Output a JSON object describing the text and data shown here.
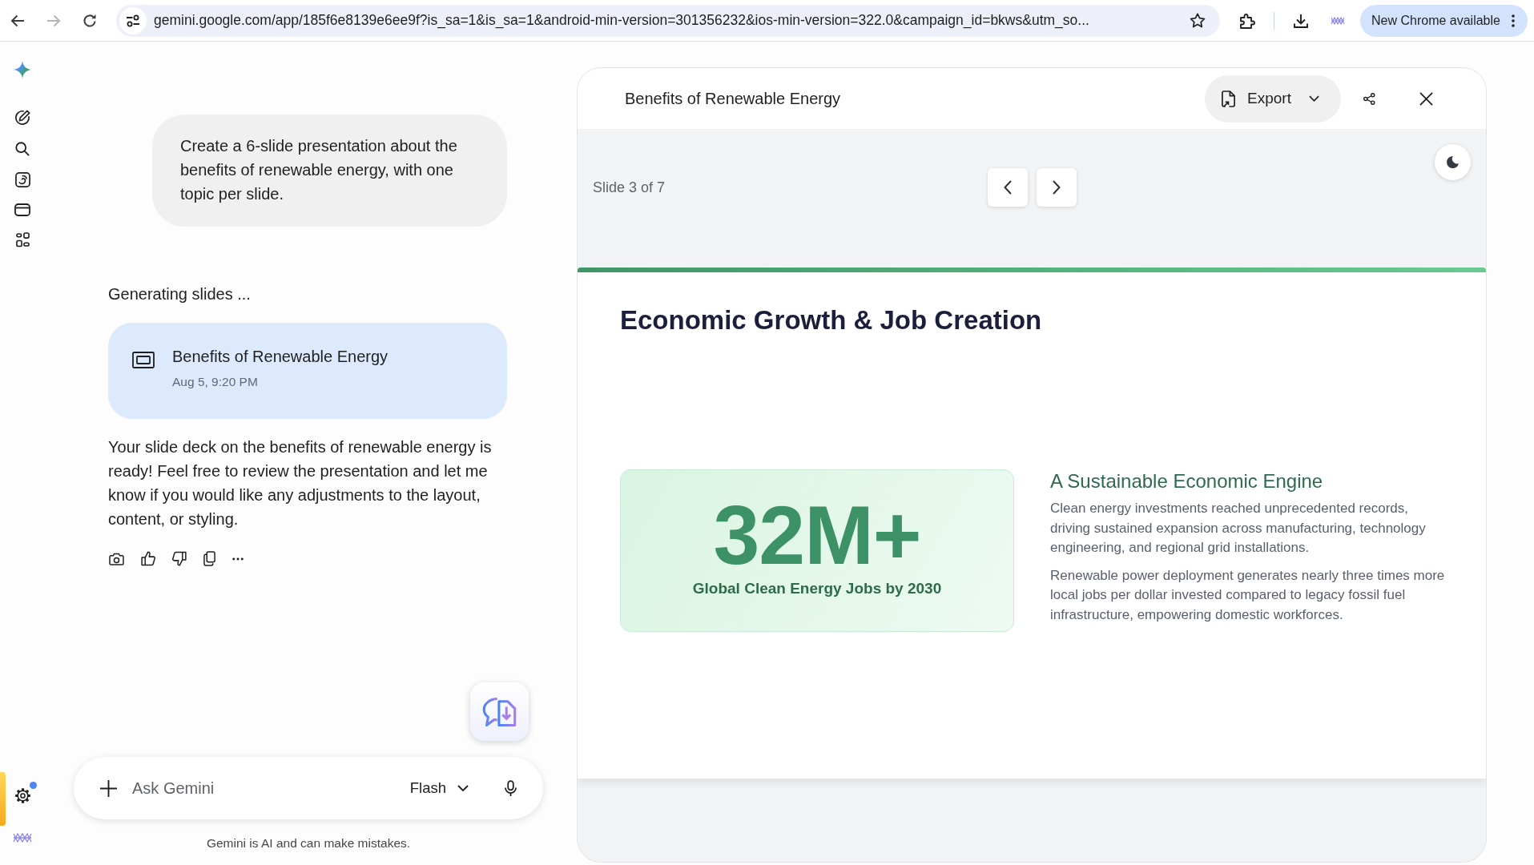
{
  "browser": {
    "nav_buttons": [
      {
        "kind": "back",
        "disabled": false
      },
      {
        "kind": "forward",
        "disabled": true
      },
      {
        "kind": "reload",
        "disabled": false
      }
    ],
    "url": "gemini.google.com/app/185f6e8139e6ee9f?is_sa=1&is_sa=1&android-min-version=301356232&ios-min-version=322.0&campaign_id=bkws&utm_so...",
    "update_button": "New Chrome available"
  },
  "sidebar": {
    "settings_notification": true
  },
  "chat": {
    "user_message": "Create a 6-slide presentation about the benefits of renewable energy, with one topic per slide.",
    "status": "Generating slides ...",
    "artifact": {
      "title": "Benefits of Renewable Energy",
      "date": "Aug 5, 9:20 PM"
    },
    "response": "Your slide deck on the benefits of renewable energy is ready! Feel free to review the presentation and let me know if you would like any adjustments to the layout, content, or styling.",
    "composer": {
      "placeholder": "Ask Gemini",
      "model": "Flash"
    },
    "disclaimer": "Gemini is AI and can make mistakes."
  },
  "panel": {
    "title": "Benefits of Renewable Energy",
    "export_button": "Export",
    "slide_counter": "Slide 3 of 7",
    "slide": {
      "title": "Economic Growth & Job Creation",
      "stat_value": "32M+",
      "stat_label": "Global Clean Energy Jobs by 2030",
      "heading": "A Sustainable Economic Engine",
      "paragraphs": [
        "Clean energy investments reached unprecedented records, driving sustained expansion across manufacturing, technology engineering, and regional grid installations.",
        "Renewable power deployment generates nearly three times more local jobs per dollar invested compared to legacy fossil fuel infrastructure, empowering domestic workforces."
      ]
    }
  }
}
